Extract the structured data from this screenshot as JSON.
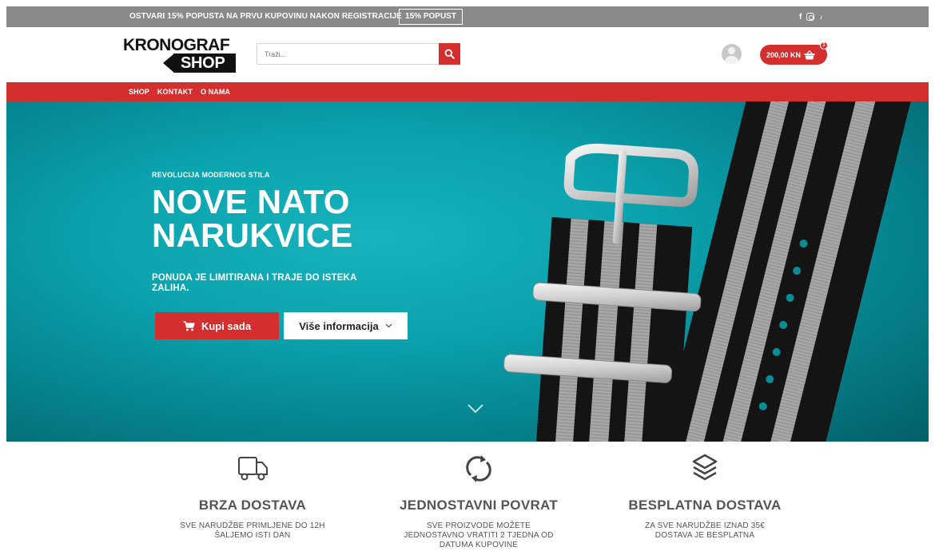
{
  "topbar": {
    "promo_text": "OSTVARI 15% POPUSTA NA PRVU KUPOVINU NAKON REGISTRACIJE",
    "promo_button": "15% POPUST",
    "social_icons": [
      "facebook-icon",
      "instagram-icon",
      "tiktok-icon"
    ],
    "facebook_glyph": "f",
    "tiktok_glyph": "♪"
  },
  "header": {
    "logo_line1": "KRONOGRAF",
    "logo_line2": "SHOP",
    "search_placeholder": "Traži...",
    "cart_total": "200,00 KN",
    "cart_count": "1"
  },
  "nav": {
    "items": [
      "SHOP",
      "KONTAKT",
      "O NAMA"
    ]
  },
  "hero": {
    "eyebrow": "REVOLUCIJA MODERNOG STILA",
    "title_line1": "NOVE NATO",
    "title_line2": "NARUKVICE",
    "subtitle": "PONUDA JE LIMITIRANA I TRAJE DO ISTEKA ZALIHA.",
    "buy_button": "Kupi sada",
    "info_button": "Više informacija"
  },
  "features": [
    {
      "icon": "truck-icon",
      "title": "BRZA DOSTAVA",
      "desc_line1": "SVE NARUDŽBE PRIMLJENE DO 12H",
      "desc_line2": "ŠALJEMO ISTI DAN",
      "desc_line3": ""
    },
    {
      "icon": "refresh-icon",
      "title": "JEDNOSTAVNI POVRAT",
      "desc_line1": "SVE PROIZVODE MOŽETE",
      "desc_line2": "JEDNOSTAVNO VRATITI 2 TJEDNA OD",
      "desc_line3": "DATUMA KUPOVINE"
    },
    {
      "icon": "layers-icon",
      "title": "BESPLATNA DOSTAVA",
      "desc_line1": "ZA SVE NARUDŽBE IZNAD 35€",
      "desc_line2": "DOSTAVA JE BESPLATNA",
      "desc_line3": ""
    }
  ],
  "colors": {
    "accent": "#d32f2f",
    "topbar": "#898989",
    "hero_teal": "#0aa3ae"
  }
}
